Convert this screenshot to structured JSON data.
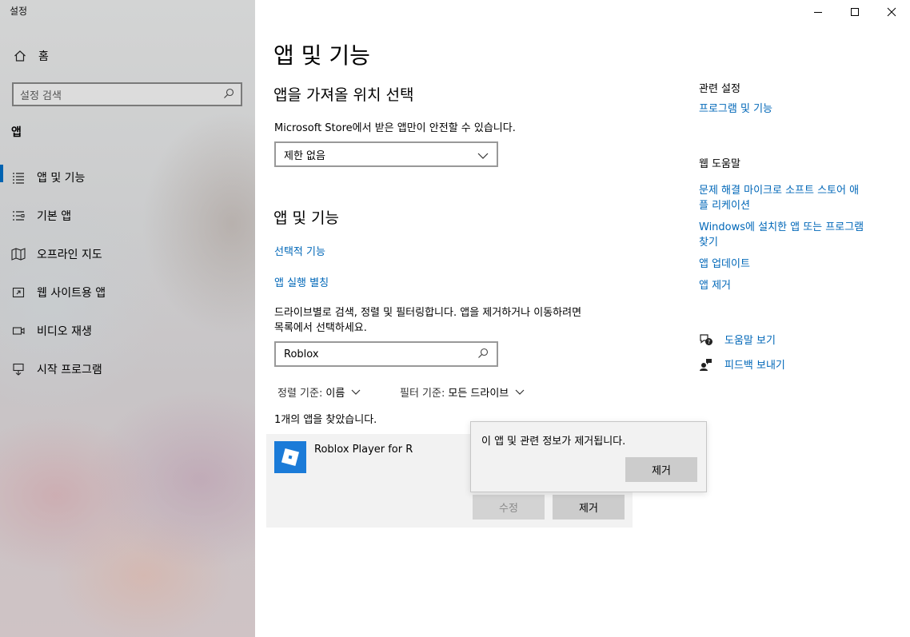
{
  "window": {
    "title": "설정",
    "controls": [
      "minimize",
      "maximize",
      "close"
    ]
  },
  "sidebar": {
    "home_label": "홈",
    "search_placeholder": "설정 검색",
    "section_label": "앱",
    "items": [
      {
        "label": "앱 및 기능",
        "icon": "apps-list-icon",
        "active": true
      },
      {
        "label": "기본 앱",
        "icon": "default-apps-icon",
        "active": false
      },
      {
        "label": "오프라인 지도",
        "icon": "map-icon",
        "active": false
      },
      {
        "label": "웹 사이트용 앱",
        "icon": "website-apps-icon",
        "active": false
      },
      {
        "label": "비디오 재생",
        "icon": "video-icon",
        "active": false
      },
      {
        "label": "시작 프로그램",
        "icon": "startup-icon",
        "active": false
      }
    ]
  },
  "main": {
    "page_title": "앱 및 기능",
    "install_section": {
      "heading": "앱을 가져올 위치 선택",
      "description": "Microsoft Store에서 받은 앱만이 안전할 수 있습니다.",
      "dropdown_value": "제한 없음"
    },
    "apps_section": {
      "heading": "앱 및 기능",
      "optional_features_link": "선택적 기능",
      "app_aliases_link": "앱 실행 별칭",
      "search_description_line1": "드라이브별로 검색, 정렬 및 필터링합니다. 앱을 제거하거나 이동하려면",
      "search_description_line2": "목록에서 선택하세요.",
      "search_value": "Roblox",
      "sort_label": "정렬 기준:",
      "sort_value": "이름",
      "filter_label": "필터 기준:",
      "filter_value": "모든 드라이브",
      "result_count": "1개의 앱을 찾았습니다.",
      "app": {
        "name": "Roblox Player for R",
        "modify_label": "수정",
        "uninstall_label": "제거"
      }
    },
    "flyout": {
      "message": "이 앱 및 관련 정보가 제거됩니다.",
      "confirm_label": "제거"
    }
  },
  "right_panel": {
    "related_heading": "관련 설정",
    "related_link": "프로그램 및 기능",
    "help_heading": "웹 도움말",
    "help_links": [
      "문제 해결 마이크로 소프트 스토어 애플 리케이션",
      "Windows에 설치한 앱 또는 프로그램 찾기",
      "앱 업데이트",
      "앱 제거"
    ],
    "help_link_lines": [
      [
        "문제 해결 마이크로 소프트 스토어 애",
        "플 리케이션"
      ],
      [
        "Windows에 설치한 앱 또는 프로그램",
        "찾기"
      ]
    ],
    "get_help": "도움말 보기",
    "feedback": "피드백 보내기"
  },
  "colors": {
    "accent": "#0067b8",
    "nav_indicator": "#0063b1",
    "roblox_icon": "#1b7bd8"
  }
}
